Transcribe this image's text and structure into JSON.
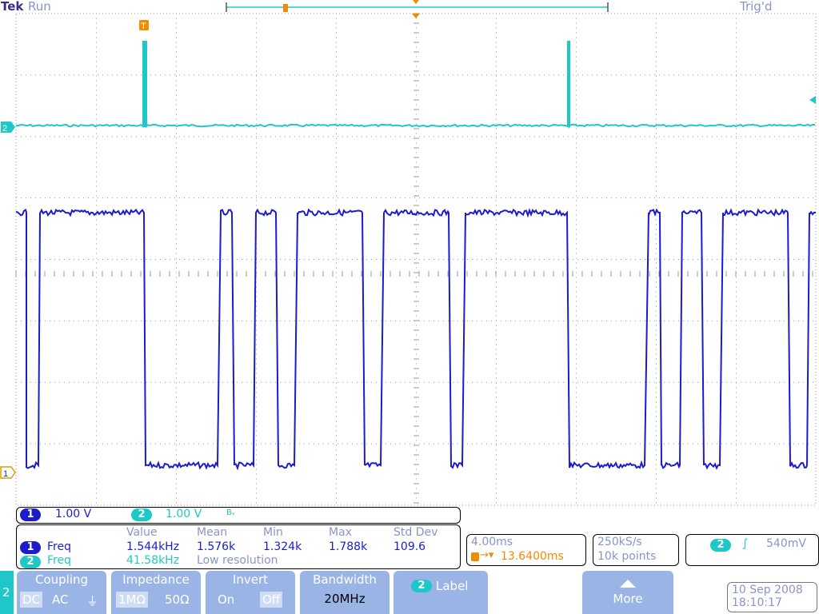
{
  "topbar": {
    "brand": "Tek",
    "run_state": "Run",
    "trigger_state": "Trig'd"
  },
  "markers": {
    "ch2_marker": "2",
    "ch1_marker": "1",
    "trigger_marker": "T"
  },
  "channel_settings": {
    "ch1": {
      "number": "1",
      "scale": "1.00 V"
    },
    "ch2": {
      "number": "2",
      "scale": "1.00 V",
      "bw_symbol": "Bᵥ"
    }
  },
  "measurements": {
    "headers": [
      "Value",
      "Mean",
      "Min",
      "Max",
      "Std Dev"
    ],
    "rows": [
      {
        "channel": "1",
        "name": "Freq",
        "value": "1.544kHz",
        "mean": "1.576k",
        "min": "1.324k",
        "max": "1.788k",
        "std": "109.6"
      },
      {
        "channel": "2",
        "name": "Freq",
        "value": "41.58kHz",
        "note": "Low resolution"
      }
    ]
  },
  "horizontal": {
    "scale": "4.00ms",
    "delay": "13.6400ms"
  },
  "acquisition": {
    "rate": "250kS/s",
    "points": "10k points"
  },
  "trigger": {
    "source": "2",
    "slope_symbol": "∫",
    "level": "540mV"
  },
  "menu": {
    "side_channel": "2",
    "coupling": {
      "title": "Coupling",
      "options": [
        "DC",
        "AC",
        "⏚"
      ]
    },
    "impedance": {
      "title": "Impedance",
      "options": [
        "1MΩ",
        "50Ω"
      ]
    },
    "invert": {
      "title": "Invert",
      "options": [
        "On",
        "Off"
      ]
    },
    "bandwidth": {
      "title": "Bandwidth",
      "value": "20MHz"
    },
    "label": {
      "channel": "2",
      "title": "Label"
    },
    "more": {
      "title": "More"
    }
  },
  "datetime": {
    "date": "10 Sep  2008",
    "time": "18:10:17"
  },
  "colors": {
    "ch1": "#1c1ccc",
    "ch2": "#1fc8c8",
    "trigger": "#f08c00",
    "grid": "#9a9a9a",
    "menu": "#9ab4e6"
  }
}
